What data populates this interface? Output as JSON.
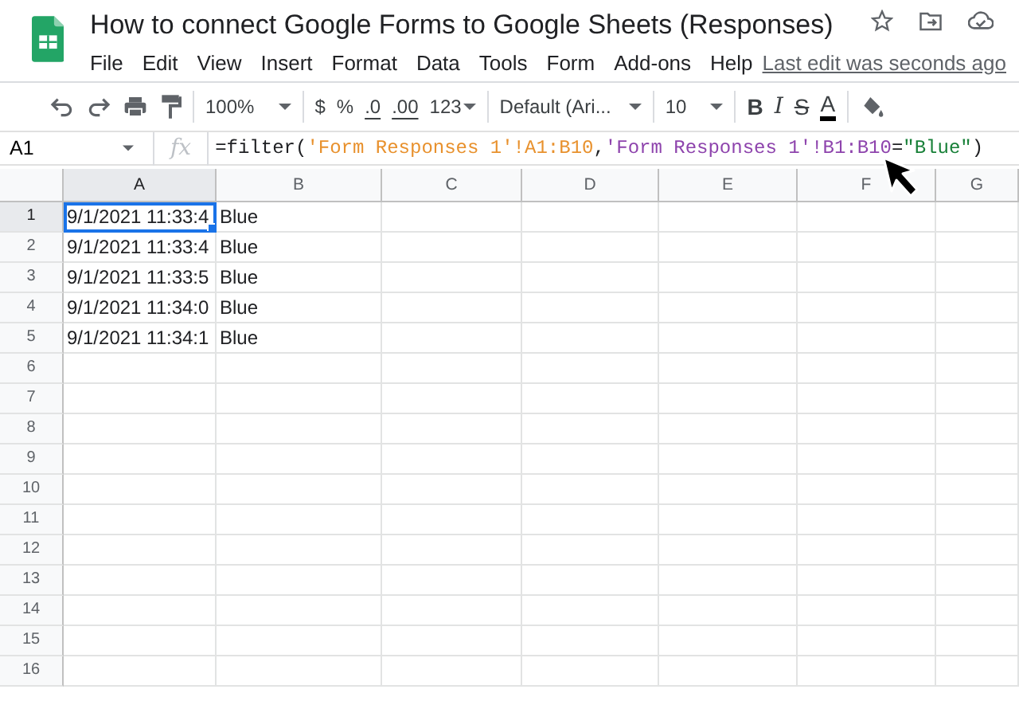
{
  "doc": {
    "title": "How to connect Google Forms to Google Sheets (Responses)",
    "last_edit": "Last edit was seconds ago"
  },
  "menu": [
    "File",
    "Edit",
    "View",
    "Insert",
    "Format",
    "Data",
    "Tools",
    "Form",
    "Add-ons",
    "Help"
  ],
  "toolbar": [
    [
      {
        "kind": "undo"
      },
      {
        "kind": "redo"
      },
      {
        "kind": "print"
      },
      {
        "kind": "paint"
      }
    ],
    [
      {
        "kind": "dropdown",
        "text": "100%"
      }
    ],
    [
      {
        "kind": "text",
        "text": "$"
      },
      {
        "kind": "text",
        "text": "%"
      },
      {
        "kind": "decimal-less",
        "text": ".0"
      },
      {
        "kind": "decimal-more",
        "text": ".00"
      },
      {
        "kind": "menu",
        "text": "123"
      }
    ],
    [
      {
        "kind": "dropdown",
        "text": "Default (Ari..."
      }
    ],
    [
      {
        "kind": "dropdown",
        "text": "10"
      }
    ],
    [
      {
        "kind": "bold",
        "text": "B"
      },
      {
        "kind": "italic",
        "text": "I"
      },
      {
        "kind": "strike",
        "text": "S"
      },
      {
        "kind": "textcolor",
        "text": "A"
      }
    ],
    [
      {
        "kind": "fill"
      }
    ]
  ],
  "name_box": "A1",
  "fx": "fx",
  "formula": [
    {
      "text": "=filter(",
      "color": "#202124"
    },
    {
      "text": "'Form Responses 1'!A1:B10",
      "color": "#e8912d"
    },
    {
      "text": ",",
      "color": "#202124"
    },
    {
      "text": "'Form Responses 1'!B1:B10",
      "color": "#8e44ad"
    },
    {
      "text": "=",
      "color": "#202124"
    },
    {
      "text": "\"Blue\"",
      "color": "#188038"
    },
    {
      "text": ")",
      "color": "#202124"
    }
  ],
  "grid": {
    "columns": [
      {
        "label": "A",
        "selected": true
      },
      {
        "label": "B",
        "selected": false
      },
      {
        "label": "C",
        "selected": false
      },
      {
        "label": "D",
        "selected": false
      },
      {
        "label": "E",
        "selected": false
      },
      {
        "label": "F",
        "selected": false
      },
      {
        "label": "G",
        "selected": false
      }
    ],
    "rows": [
      {
        "label": "1",
        "selected": true,
        "cells": [
          "9/1/2021 11:33:4",
          "Blue"
        ]
      },
      {
        "label": "2",
        "selected": false,
        "cells": [
          "9/1/2021 11:33:4",
          "Blue"
        ]
      },
      {
        "label": "3",
        "selected": false,
        "cells": [
          "9/1/2021 11:33:5",
          "Blue"
        ]
      },
      {
        "label": "4",
        "selected": false,
        "cells": [
          "9/1/2021 11:34:0",
          "Blue"
        ]
      },
      {
        "label": "5",
        "selected": false,
        "cells": [
          "9/1/2021 11:34:1",
          "Blue"
        ]
      },
      {
        "label": "6",
        "selected": false
      },
      {
        "label": "7",
        "selected": false
      },
      {
        "label": "8",
        "selected": false
      },
      {
        "label": "9",
        "selected": false
      },
      {
        "label": "10",
        "selected": false
      },
      {
        "label": "11",
        "selected": false
      },
      {
        "label": "12",
        "selected": false
      },
      {
        "label": "13",
        "selected": false
      },
      {
        "label": "14",
        "selected": false
      },
      {
        "label": "15",
        "selected": false
      },
      {
        "label": "16",
        "selected": false
      }
    ]
  }
}
